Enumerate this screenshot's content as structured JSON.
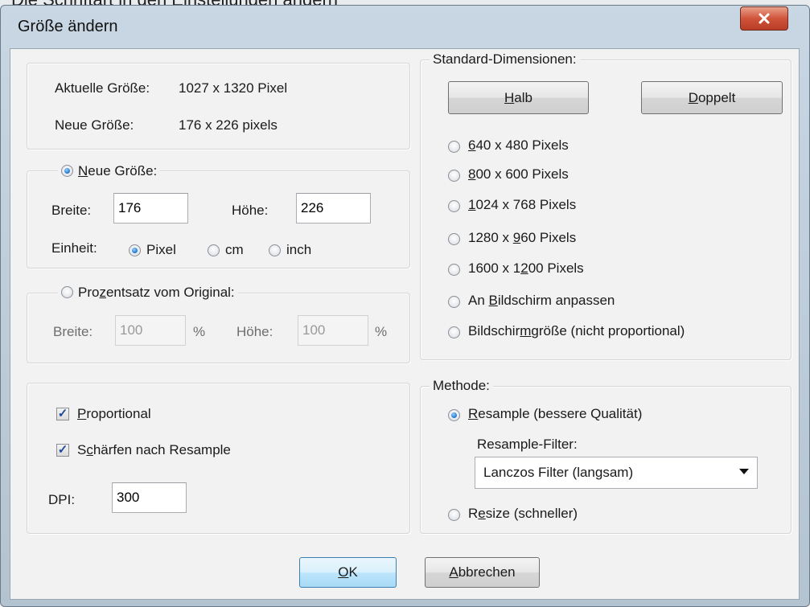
{
  "window": {
    "title": "Größe ändern",
    "top_strip_text": "Die Schriftart in den Einstellungen ändern"
  },
  "size_info": {
    "current_label": "Aktuelle Größe:",
    "current_value": "1027  x  1320  Pixel",
    "new_label": "Neue Größe:",
    "new_value": "176  x  226  pixels"
  },
  "new_size": {
    "radio_label_prefix": "",
    "radio_label_u": "N",
    "radio_label_rest": "eue Größe:",
    "width_label": "Breite:",
    "width_value": "176",
    "height_label": "Höhe:",
    "height_value": "226",
    "unit_label": "Einheit:",
    "unit_pixel": "Pixel",
    "unit_cm": "cm",
    "unit_inch": "inch"
  },
  "percent": {
    "radio_label_prefix": "Pro",
    "radio_label_u": "z",
    "radio_label_rest": "entsatz vom Original:",
    "width_label": "Breite:",
    "width_value": "100",
    "width_unit": "%",
    "height_label": "Höhe:",
    "height_value": "100",
    "height_unit": "%"
  },
  "options": {
    "proportional_u": "P",
    "proportional_rest": "roportional",
    "sharpen_prefix": "S",
    "sharpen_u": "c",
    "sharpen_rest": "härfen nach Resample",
    "dpi_label": "DPI:",
    "dpi_value": "300"
  },
  "standard": {
    "legend": "Standard-Dimensionen:",
    "half_u": "H",
    "half_rest": "alb",
    "double_u": "D",
    "double_rest": "oppelt",
    "items": [
      {
        "u": "6",
        "rest": "40 x 480 Pixels",
        "prefix": ""
      },
      {
        "u": "8",
        "rest": "00 x 600 Pixels",
        "prefix": ""
      },
      {
        "u": "1",
        "rest": "024 x 768 Pixels",
        "prefix": ""
      },
      {
        "prefix": "1280 x ",
        "u": "9",
        "rest": "60 Pixels"
      },
      {
        "prefix": "1600 x 1",
        "u": "2",
        "rest": "00 Pixels"
      },
      {
        "prefix": "An ",
        "u": "B",
        "rest": "ildschirm anpassen"
      },
      {
        "prefix": "Bildschir",
        "u": "m",
        "rest": "größe (nicht proportional)"
      }
    ]
  },
  "method": {
    "legend": "Methode:",
    "resample_u": "R",
    "resample_rest": "esample (bessere Qualität)",
    "filter_label": "Resample-Filter:",
    "filter_value": "Lanczos Filter (langsam)",
    "resize_prefix": "R",
    "resize_u": "e",
    "resize_rest": "size (schneller)"
  },
  "footer": {
    "ok_u": "O",
    "ok_rest": "K",
    "cancel_u": "A",
    "cancel_rest": "bbrechen"
  },
  "icons": {
    "close": "close-icon",
    "dropdown": "chevron-down-icon"
  },
  "colors": {
    "close_button": "#c9462d",
    "default_button": "#bee6fd",
    "radio_checked": "#2a7fd4"
  }
}
